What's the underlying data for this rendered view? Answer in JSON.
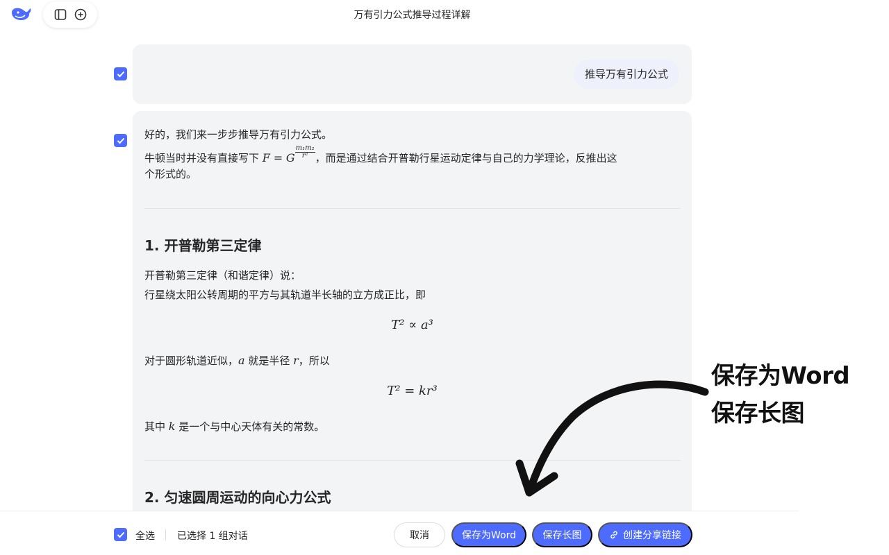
{
  "header": {
    "title": "万有引力公式推导过程详解"
  },
  "conversation": {
    "user_message": "推导万有引力公式",
    "ai": {
      "intro_line1": "好的，我们来一步步推导万有引力公式。",
      "intro_line2_prefix": "牛顿当时并没有直接写下",
      "intro_formula_lhs": "F",
      "intro_formula_eq": "=",
      "intro_formula_g": "G",
      "intro_formula_num": "m₁m₂",
      "intro_formula_den": "r²",
      "intro_line2_suffix": "，而是通过结合开普勒行星运动定律与自己的力学理论，反推出这",
      "intro_line3": "个形式的。",
      "section1_title": "1. 开普勒第三定律",
      "section1_p1": "开普勒第三定律（和谐定律）说：",
      "section1_p2": "行星绕太阳公转周期的平方与其轨道半长轴的立方成正比，即",
      "formula1": "T² ∝ a³",
      "section1_p3_prefix": "对于圆形轨道近似，",
      "section1_var_a": "a",
      "section1_p3_mid": " 就是半径 ",
      "section1_var_r": "r",
      "section1_p3_suffix": "，所以",
      "formula2": "T² = kr³",
      "section1_p4_prefix": "其中 ",
      "section1_var_k": "k",
      "section1_p4_suffix": " 是一个与中心天体有关的常数。",
      "section2_title": "2. 匀速圆周运动的向心力公式"
    }
  },
  "bottom_bar": {
    "select_all_label": "全选",
    "selected_count": "已选择 1 组对话",
    "cancel_label": "取消",
    "save_word_label": "保存为Word",
    "save_image_label": "保存长图",
    "share_label": "创建分享链接"
  },
  "annotation": {
    "line1": "保存为Word",
    "line2": "保存长图"
  },
  "colors": {
    "accent": "#4d6bfe",
    "card_bg": "#f3f4f6",
    "text": "#262626"
  },
  "icons": [
    "whale-logo-icon",
    "sidebar-toggle-icon",
    "new-chat-icon",
    "checkbox-checked-icon",
    "link-icon",
    "hand-drawn-arrow-icon"
  ]
}
